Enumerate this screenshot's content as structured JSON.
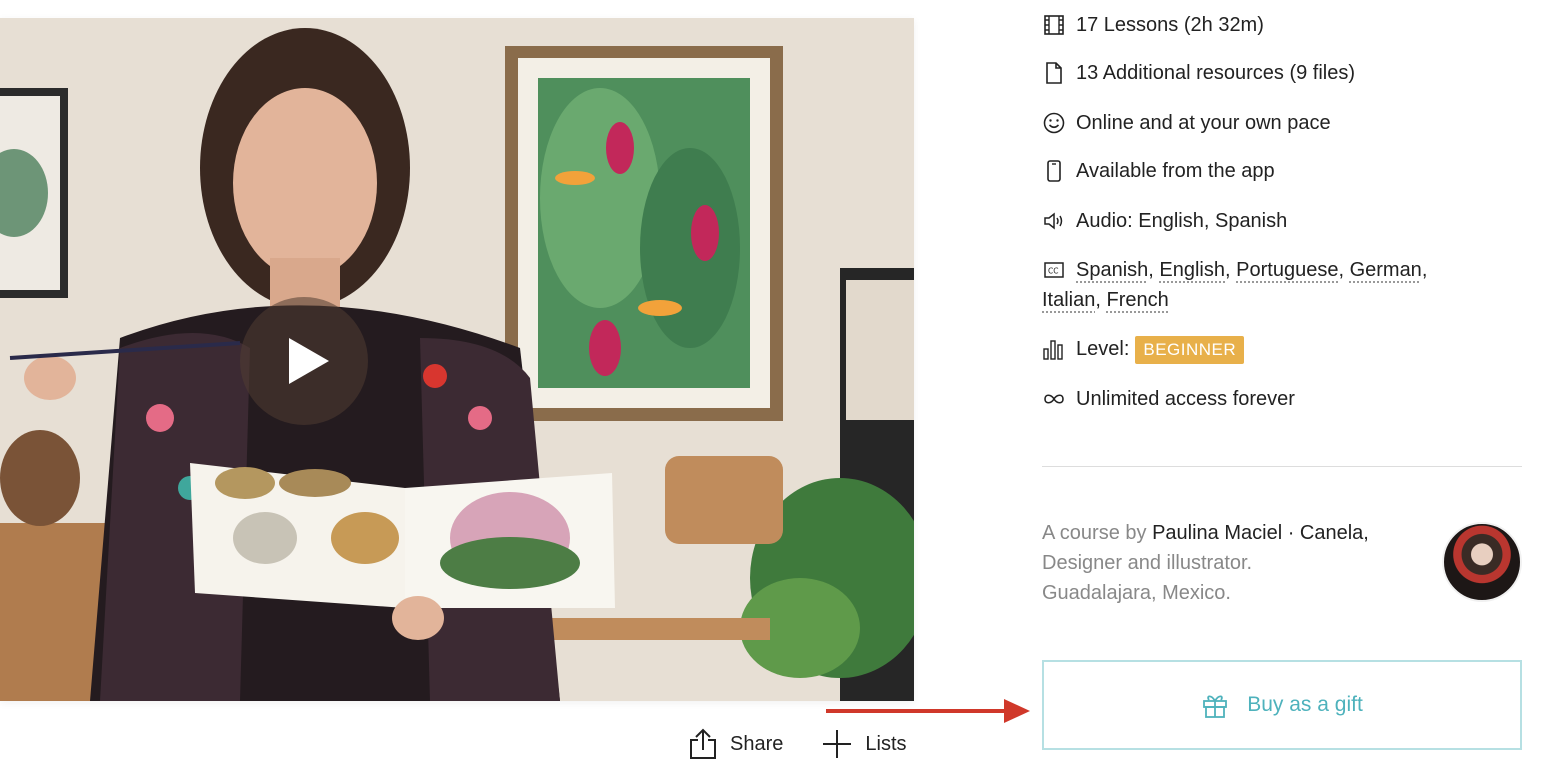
{
  "video": {
    "play_icon": "play-icon",
    "image_description_icon": "course-trailer-thumbnail"
  },
  "actions": {
    "share_label": "Share",
    "lists_label": "Lists"
  },
  "features": {
    "lessons": "17 Lessons (2h 32m)",
    "resources": "13 Additional resources (9 files)",
    "pace": "Online and at your own pace",
    "app": "Available from the app",
    "audio": "Audio: English, Spanish",
    "subtitles": [
      "Spanish",
      "English",
      "Portuguese",
      "German",
      "Italian",
      "French"
    ],
    "level_label": "Level:",
    "level_value": "BEGINNER",
    "access": "Unlimited access forever"
  },
  "author": {
    "prefix": "A course by",
    "name": "Paulina Maciel · Canela,",
    "role": "Designer and illustrator.",
    "location": "Guadalajara, Mexico."
  },
  "gift": {
    "label": "Buy as a gift"
  },
  "colors": {
    "badge": "#e8b04a",
    "gift_text": "#4eb2bc",
    "gift_border": "#b6e0e3",
    "arrow": "#d0382a"
  }
}
